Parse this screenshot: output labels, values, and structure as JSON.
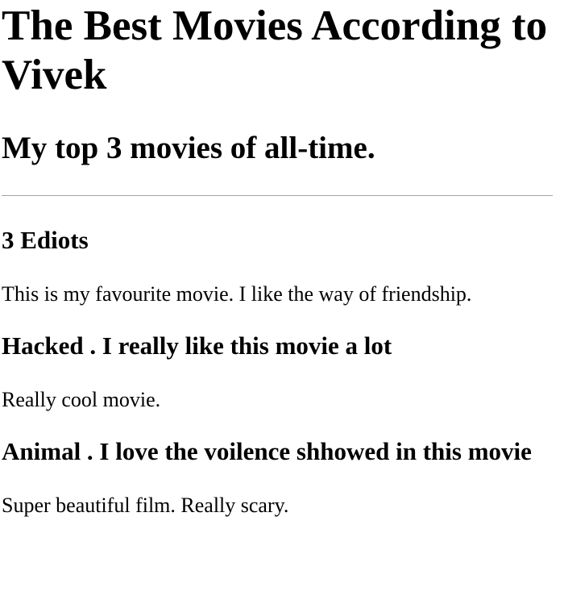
{
  "page": {
    "title": "The Best Movies According to Vivek",
    "subtitle": "My top 3 movies of all-time."
  },
  "movies": [
    {
      "title": "3 Ediots",
      "description": "This is my favourite movie. I like the way of friendship."
    },
    {
      "title": "Hacked . I really like this movie a lot",
      "description": "Really cool movie."
    },
    {
      "title": "Animal . I love the voilence shhowed in this movie",
      "description": "Super beautiful film. Really scary."
    }
  ]
}
